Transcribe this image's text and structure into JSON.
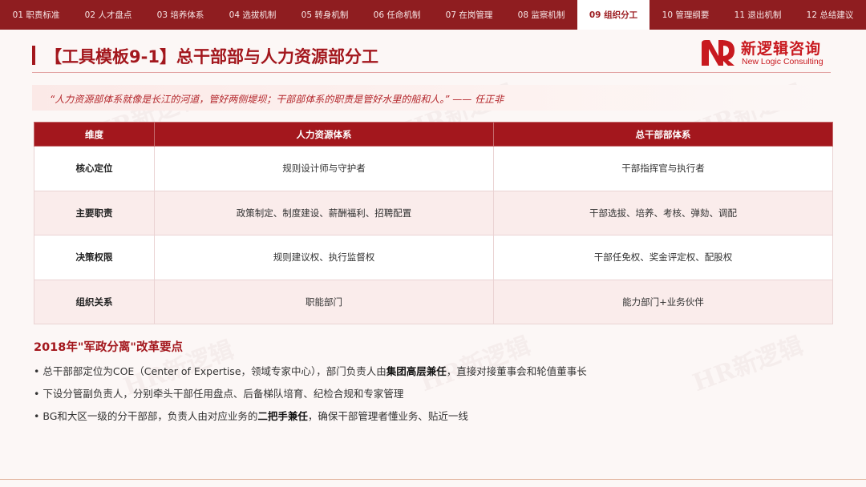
{
  "nav": {
    "tabs": [
      {
        "label": "01 职责标准"
      },
      {
        "label": "02 人才盘点"
      },
      {
        "label": "03 培养体系"
      },
      {
        "label": "04 选拔机制"
      },
      {
        "label": "05 转身机制"
      },
      {
        "label": "06 任命机制"
      },
      {
        "label": "07 在岗管理"
      },
      {
        "label": "08 监察机制"
      },
      {
        "label": "09 组织分工"
      },
      {
        "label": "10 管理纲要"
      },
      {
        "label": "11 退出机制"
      },
      {
        "label": "12 总结建议"
      }
    ],
    "active_index": 8
  },
  "header": {
    "title": "【工具模板9-1】总干部部与人力资源部分工",
    "logo_cn": "新逻辑咨询",
    "logo_en": "New Logic Consulting"
  },
  "quote": "“人力资源部体系就像是长江的河道，管好两侧堤坝；干部部体系的职责是管好水里的船和人。” —— 任正非",
  "table": {
    "headers": [
      "维度",
      "人力资源体系",
      "总干部部体系"
    ],
    "rows": [
      {
        "dimension": "核心定位",
        "hr": "规则设计师与守护者",
        "cadre": "干部指挥官与执行者"
      },
      {
        "dimension": "主要职责",
        "hr": "政策制定、制度建设、薪酬福利、招聘配置",
        "cadre": "干部选拔、培养、考核、弹劾、调配"
      },
      {
        "dimension": "决策权限",
        "hr": "规则建议权、执行监督权",
        "cadre": "干部任免权、奖金评定权、配股权"
      },
      {
        "dimension": "组织关系",
        "hr": "职能部门",
        "cadre": "能力部门+业务伙伴"
      }
    ]
  },
  "reform": {
    "title": "2018年\"军政分离\"改革要点",
    "bullets": [
      {
        "pre": "• 总干部部定位为COE（Center of Expertise，领域专家中心），部门负责人由",
        "bold": "集团高层兼任",
        "post": "，直接对接董事会和轮值董事长"
      },
      {
        "pre": "• 下设分管副负责人，分别牵头干部任用盘点、后备梯队培育、纪检合规和专家管理",
        "bold": "",
        "post": ""
      },
      {
        "pre": "• BG和大区一级的分干部部，负责人由对应业务的",
        "bold": "二把手兼任",
        "post": "，确保干部管理者懂业务、贴近一线"
      }
    ]
  },
  "watermark": "HR新逻辑",
  "colors": {
    "brand_red": "#a3171d",
    "nav_bg": "#8f1d20",
    "logo_red": "#c8191f"
  }
}
